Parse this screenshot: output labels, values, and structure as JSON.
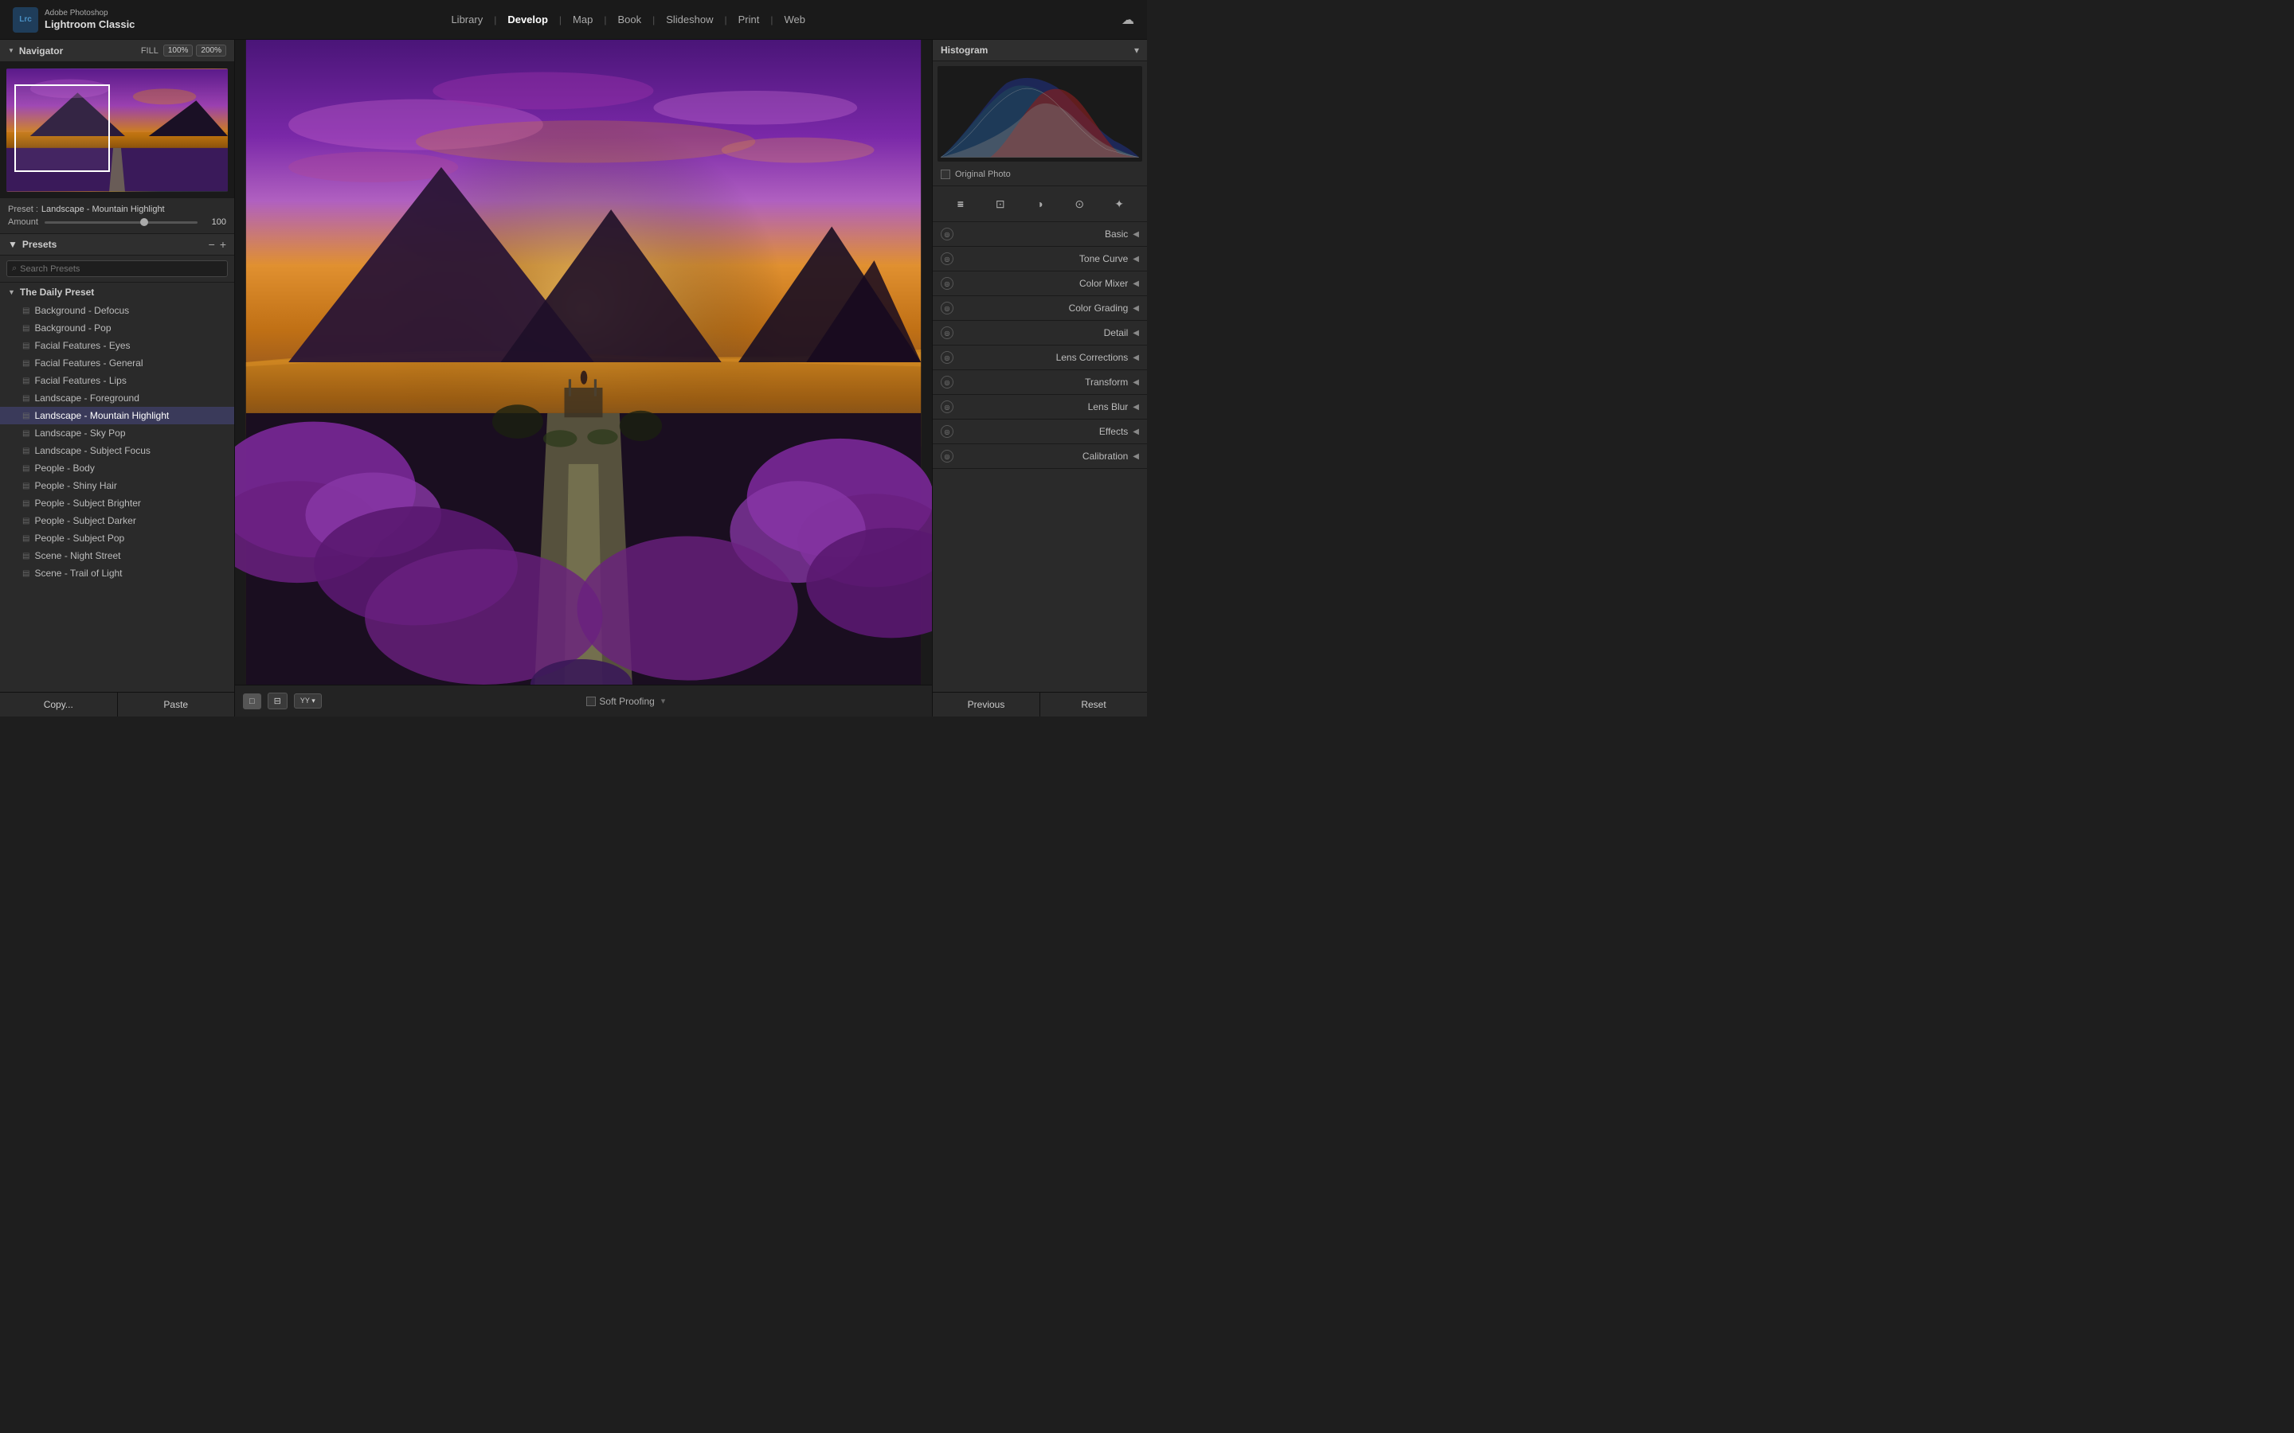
{
  "app": {
    "company": "Adobe Photoshop",
    "name": "Lightroom Classic",
    "logo_text": "Lrc"
  },
  "top_nav": {
    "items": [
      {
        "label": "Library",
        "active": false
      },
      {
        "label": "Develop",
        "active": true
      },
      {
        "label": "Map",
        "active": false
      },
      {
        "label": "Book",
        "active": false
      },
      {
        "label": "Slideshow",
        "active": false
      },
      {
        "label": "Print",
        "active": false
      },
      {
        "label": "Web",
        "active": false
      }
    ]
  },
  "navigator": {
    "title": "Navigator",
    "fill_label": "FILL",
    "zoom_100": "100%",
    "zoom_200": "200%"
  },
  "preset_info": {
    "label": "Preset :",
    "name": "Landscape - Mountain Highlight",
    "amount_label": "Amount",
    "amount_value": "100"
  },
  "presets_panel": {
    "title": "Presets",
    "search_placeholder": "Search Presets",
    "minus_label": "−",
    "plus_label": "+",
    "groups": [
      {
        "name": "The Daily Preset",
        "expanded": true,
        "items": [
          {
            "label": "Background - Defocus",
            "active": false
          },
          {
            "label": "Background - Pop",
            "active": false
          },
          {
            "label": "Facial Features - Eyes",
            "active": false
          },
          {
            "label": "Facial Features - General",
            "active": false
          },
          {
            "label": "Facial Features - Lips",
            "active": false
          },
          {
            "label": "Landscape - Foreground",
            "active": false
          },
          {
            "label": "Landscape - Mountain Highlight",
            "active": true
          },
          {
            "label": "Landscape - Sky Pop",
            "active": false
          },
          {
            "label": "Landscape - Subject Focus",
            "active": false
          },
          {
            "label": "People - Body",
            "active": false
          },
          {
            "label": "People - Shiny Hair",
            "active": false
          },
          {
            "label": "People - Subject Brighter",
            "active": false
          },
          {
            "label": "People - Subject Darker",
            "active": false
          },
          {
            "label": "People - Subject Pop",
            "active": false
          },
          {
            "label": "Scene - Night Street",
            "active": false
          },
          {
            "label": "Scene - Trail of Light",
            "active": false
          }
        ]
      }
    ]
  },
  "left_bottom": {
    "copy_label": "Copy...",
    "paste_label": "Paste"
  },
  "histogram": {
    "title": "Histogram"
  },
  "original_photo": {
    "label": "Original Photo"
  },
  "tool_icons": [
    {
      "name": "basic-adjustments-icon",
      "symbol": "≡"
    },
    {
      "name": "crop-icon",
      "symbol": "⊡"
    },
    {
      "name": "masking-icon",
      "symbol": "◑"
    },
    {
      "name": "redeye-icon",
      "symbol": "⊙"
    },
    {
      "name": "settings-icon",
      "symbol": "✦"
    }
  ],
  "right_sections": [
    {
      "name": "Basic",
      "key": "basic"
    },
    {
      "name": "Tone Curve",
      "key": "tone-curve"
    },
    {
      "name": "Color Mixer",
      "key": "color-mixer"
    },
    {
      "name": "Color Grading",
      "key": "color-grading"
    },
    {
      "name": "Detail",
      "key": "detail"
    },
    {
      "name": "Lens Corrections",
      "key": "lens-corrections"
    },
    {
      "name": "Transform",
      "key": "transform"
    },
    {
      "name": "Lens Blur",
      "key": "lens-blur"
    },
    {
      "name": "Effects",
      "key": "effects"
    },
    {
      "name": "Calibration",
      "key": "calibration"
    }
  ],
  "right_bottom": {
    "previous_label": "Previous",
    "reset_label": "Reset"
  },
  "bottom_toolbar": {
    "soft_proofing_label": "Soft Proofing",
    "view_single": "□",
    "view_grid": "⊞"
  }
}
